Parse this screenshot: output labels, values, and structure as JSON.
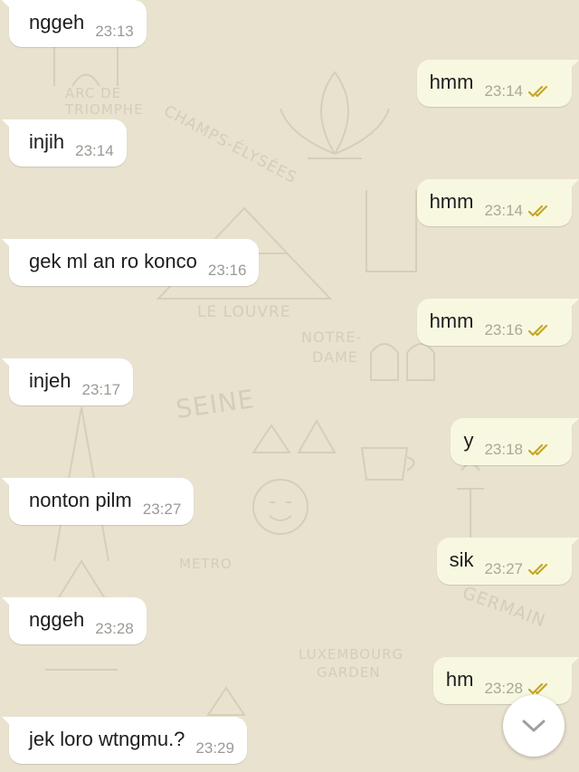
{
  "wallpaper": {
    "labels": {
      "arc": "ARC DE",
      "triomphe": "TRIOMPHE",
      "champs": "CHAMPS-ÉLYSÉES",
      "louvre": "LE LOUVRE",
      "notre": "NOTRE-",
      "dame": "DAME",
      "seine": "SEINE",
      "metro": "METRO",
      "germain": "GERMAIN",
      "luxembourg": "LUXEMBOURG",
      "garden": "GARDEN"
    }
  },
  "messages": [
    {
      "direction": "incoming",
      "text": "nggeh",
      "time": "23:13"
    },
    {
      "direction": "outgoing",
      "text": "hmm",
      "time": "23:14",
      "status": "read"
    },
    {
      "direction": "incoming",
      "text": "injih",
      "time": "23:14"
    },
    {
      "direction": "outgoing",
      "text": "hmm",
      "time": "23:14",
      "status": "read"
    },
    {
      "direction": "incoming",
      "text": "gek ml an ro konco",
      "time": "23:16"
    },
    {
      "direction": "outgoing",
      "text": "hmm",
      "time": "23:16",
      "status": "read"
    },
    {
      "direction": "incoming",
      "text": "injeh",
      "time": "23:17"
    },
    {
      "direction": "outgoing",
      "text": "y",
      "time": "23:18",
      "status": "read"
    },
    {
      "direction": "incoming",
      "text": "nonton pilm",
      "time": "23:27"
    },
    {
      "direction": "outgoing",
      "text": "sik",
      "time": "23:27",
      "status": "read"
    },
    {
      "direction": "incoming",
      "text": "nggeh",
      "time": "23:28"
    },
    {
      "direction": "outgoing",
      "text": "hm",
      "time": "23:28",
      "status": "read"
    },
    {
      "direction": "incoming",
      "text": "jek loro wtngmu.?",
      "time": "23:29"
    }
  ],
  "colors": {
    "wallpaper": "#e8e2cf",
    "incoming_bubble": "#ffffff",
    "outgoing_bubble": "#f8f8e1",
    "read_ticks": "#c4a729"
  },
  "scroll_button": {
    "icon": "chevron-down-icon"
  }
}
